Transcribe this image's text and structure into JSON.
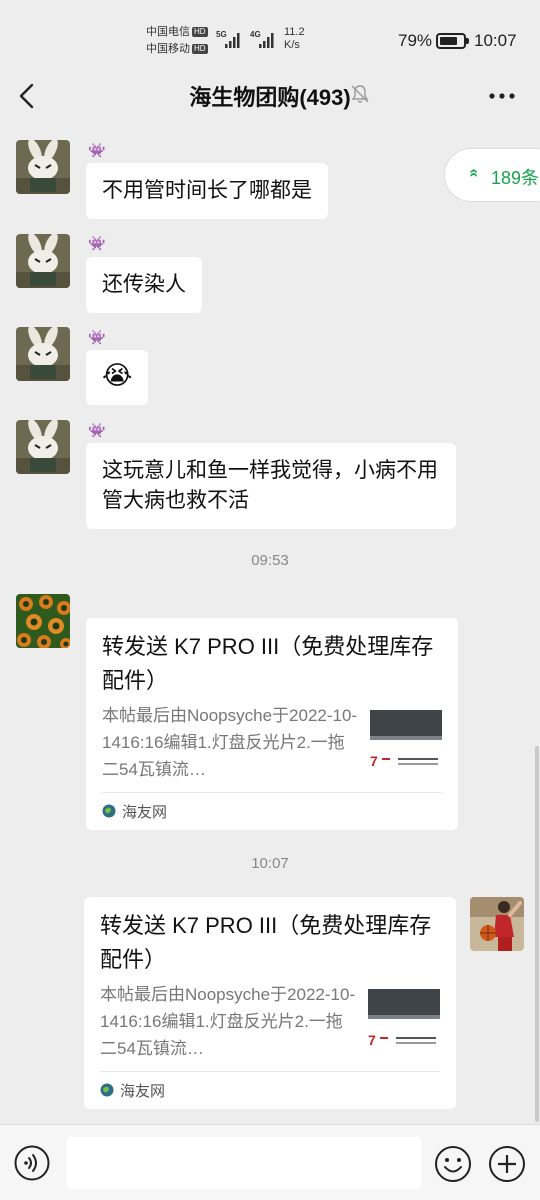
{
  "status_bar": {
    "carrier1": "中国电信",
    "carrier2": "中国移动",
    "hd": "HD",
    "net1": "5G",
    "net2": "4G",
    "speed_value": "11.2",
    "speed_unit": "K/s",
    "battery_pct": "79%",
    "battery_level": 0.79,
    "time": "10:07"
  },
  "header": {
    "title": "海生物团购(493)",
    "back_icon": "chevron-left-icon",
    "mute_icon": "bell-off-icon",
    "more_icon": "more-dots-icon"
  },
  "unread": {
    "chevron": "«",
    "count_text": "189条"
  },
  "messages": [
    {
      "nick": "👾",
      "text": "不用管时间长了哪都是"
    },
    {
      "nick": "👾",
      "text": "还传染人"
    },
    {
      "nick": "👾",
      "text": "😭"
    },
    {
      "nick": "👾",
      "text": "这玩意儿和鱼一样我觉得，小病不用管大病也救不活"
    }
  ],
  "timestamps": [
    "09:53",
    "10:07"
  ],
  "cards": [
    {
      "title": "转发送 K7 PRO III（免费处理库存配件）",
      "desc": "本帖最后由Noopsyche于2022-10-1416:16编辑1.灯盘反光片2.一拖二54瓦镇流…",
      "source": "海友网"
    },
    {
      "title": "转发送 K7 PRO III（免费处理库存配件）",
      "desc": "本帖最后由Noopsyche于2022-10-1416:16编辑1.灯盘反光片2.一拖二54瓦镇流…",
      "source": "海友网"
    }
  ],
  "input_bar": {
    "voice_icon": "voice-icon",
    "emoji_icon": "emoji-icon",
    "plus_icon": "plus-icon",
    "placeholder": ""
  },
  "colors": {
    "background": "#ededed",
    "accent_green": "#19a34d",
    "nick_purple": "#8a3fb0"
  }
}
